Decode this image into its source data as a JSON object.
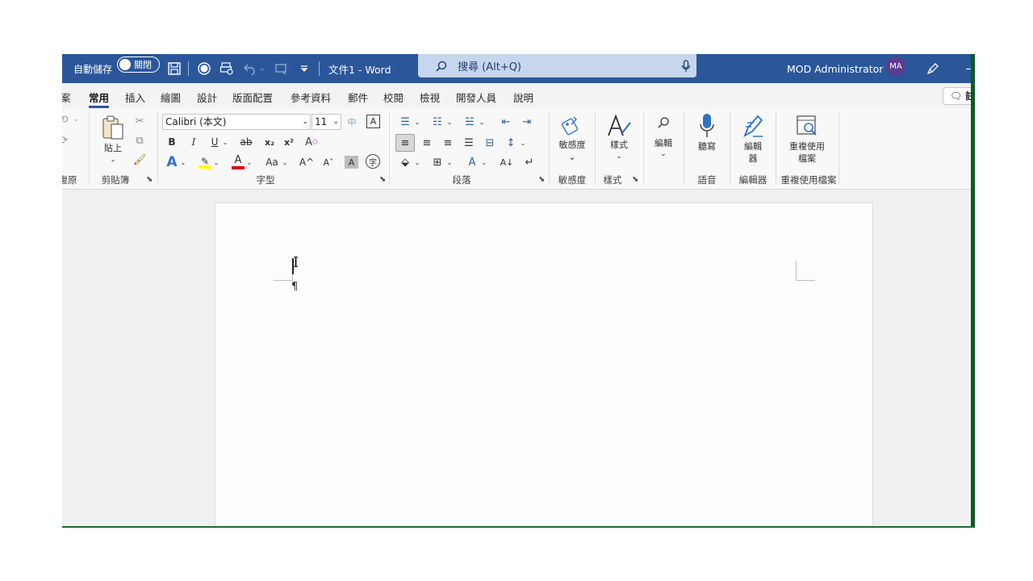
{
  "titlebar": {
    "autosave_label": "自動儲存",
    "autosave_state": "關閉",
    "doc_title": "文件1 - Word",
    "search_placeholder": "搜尋 (Alt+Q)",
    "user_name": "MOD Administrator",
    "user_initials": "MA",
    "accent": "#2b579a"
  },
  "tabs": {
    "items": [
      "案",
      "常用",
      "插入",
      "繪圖",
      "設計",
      "版面配置",
      "參考資料",
      "郵件",
      "校閱",
      "檢視",
      "開發人員",
      "說明"
    ],
    "active": "常用",
    "comment_label": "註"
  },
  "ribbon": {
    "undo_group_label": "復原",
    "clipboard": {
      "label": "剪貼簿",
      "paste": "貼上"
    },
    "font": {
      "label": "字型",
      "font_name": "Calibri (本文)",
      "font_size": "11",
      "bold": "B",
      "italic": "I",
      "underline": "U",
      "strike": "ab",
      "subscript": "x₂",
      "superscript": "x²",
      "case": "Aa",
      "grow": "A^",
      "shrink": "Aˇ",
      "highlight_color": "#ffff00",
      "font_color": "#e00000"
    },
    "paragraph": {
      "label": "段落"
    },
    "sensitivity": {
      "label": "敏感度",
      "button": "敏感度"
    },
    "styles": {
      "label": "樣式",
      "button": "樣式"
    },
    "editing": {
      "button": "編輯"
    },
    "voice": {
      "label": "語音",
      "button": "聽寫"
    },
    "editor": {
      "label": "編輯器",
      "button": "編輯器"
    },
    "reuse": {
      "label": "重複使用檔案",
      "button": "重複使用檔案"
    }
  }
}
